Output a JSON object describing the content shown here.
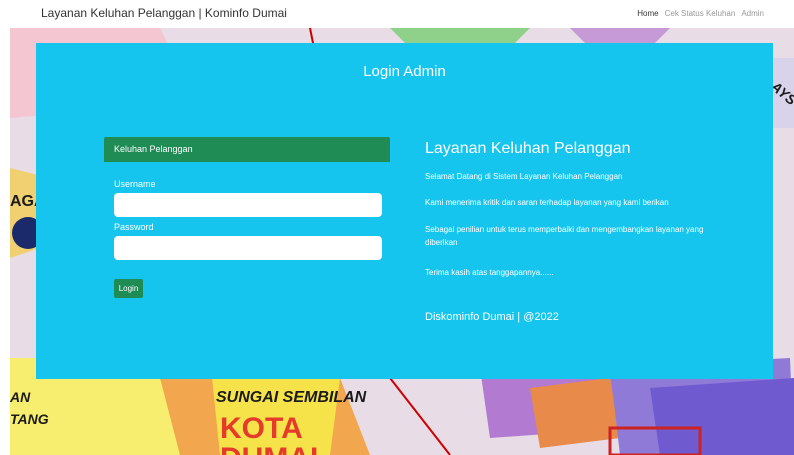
{
  "header": {
    "brand": "Layanan Keluhan Pelanggan | Kominfo Dumai",
    "nav": [
      "Home",
      "Cek Status Keluhan",
      "Admin"
    ]
  },
  "background": {
    "labels": [
      "AGA",
      "AN",
      "TANG",
      "SUNGAI SEMBILAN",
      "KOTA",
      "DUMAI",
      "AYS"
    ]
  },
  "panel": {
    "title": "Login Admin",
    "card_header": "Keluhan Pelanggan",
    "username_label": "Username",
    "username_value": "",
    "password_label": "Password",
    "password_value": "",
    "login_button": "Login"
  },
  "info": {
    "title": "Layanan Keluhan Pelanggan",
    "lines": [
      "Selamat Datang di Sistem Layanan Keluhan Pelanggan",
      "Kami menerima kritik dan saran terhadap layanan yang kami berikan",
      "Sebagai penilian untuk terus memperbaiki dan mengembangkan layanan yang diberikan",
      "Terima kasih atas tanggapannya......"
    ],
    "footer": "Diskominfo Dumai | @2022"
  },
  "colors": {
    "panel": "#16c5ee",
    "accent": "#1f8b55"
  }
}
